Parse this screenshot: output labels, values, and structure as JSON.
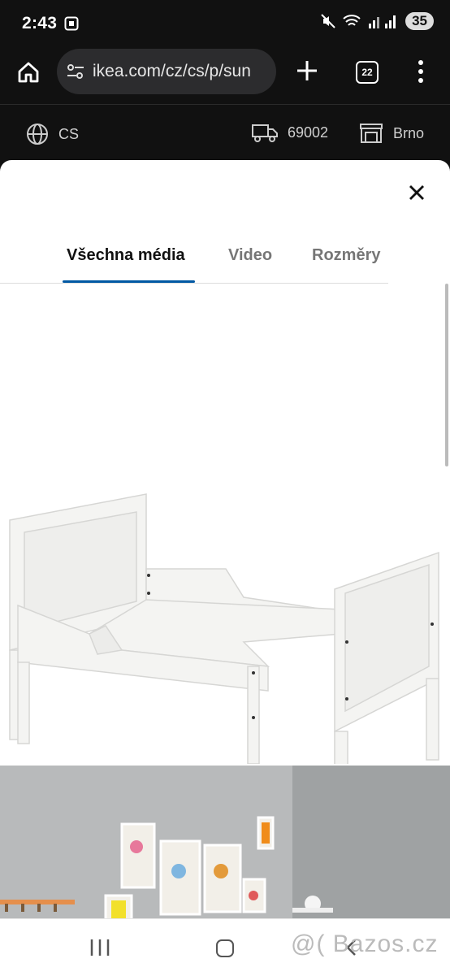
{
  "status": {
    "time": "2:43",
    "battery": "35"
  },
  "browser": {
    "url": "ikea.com/cz/cs/p/sun",
    "tab_count": "22"
  },
  "ikea_strip": {
    "language": "CS",
    "zip": "69002",
    "store": "Brno"
  },
  "media_viewer": {
    "tabs": [
      {
        "label": "Všechna média"
      },
      {
        "label": "Video"
      },
      {
        "label": "Rozměry"
      }
    ],
    "active_tab": 0
  },
  "watermark": "@( Bazos.cz",
  "icons": [
    "screen-record-icon",
    "mute-icon",
    "wifi-icon",
    "signal-icon",
    "home-icon",
    "tune-icon",
    "plus-icon",
    "tabs-icon",
    "more-icon",
    "globe-icon",
    "truck-icon",
    "store-icon",
    "close-icon",
    "recents-icon",
    "nav-home-icon",
    "back-icon"
  ]
}
